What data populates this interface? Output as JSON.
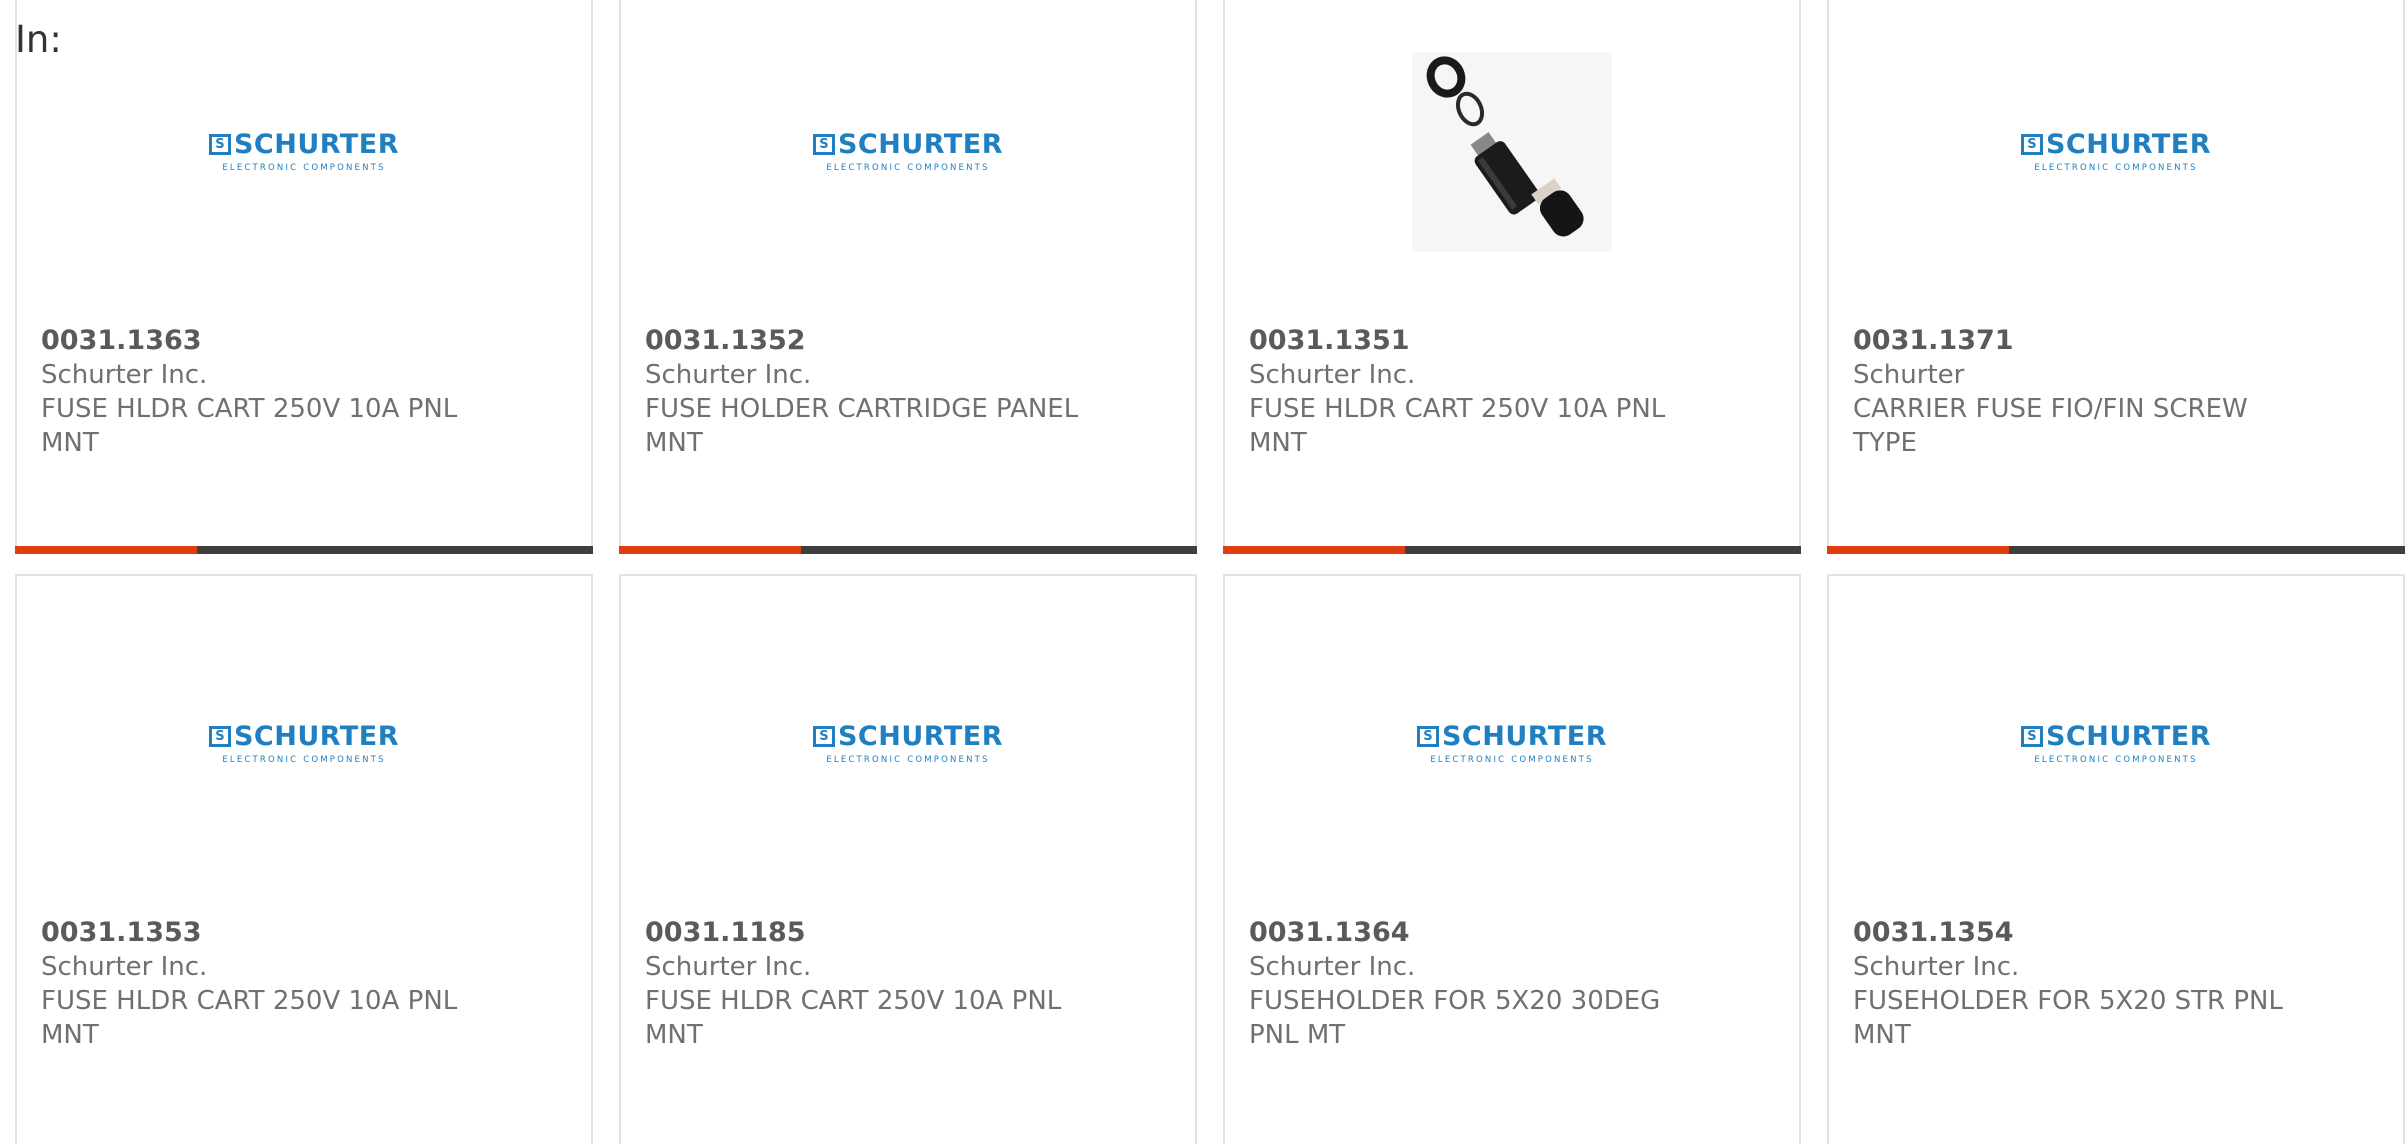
{
  "page": {
    "heading": "In:"
  },
  "brand": {
    "mark": "S",
    "name": "SCHURTER",
    "sub": "ELECTRONIC COMPONENTS",
    "color": "#1f7fc1"
  },
  "colors": {
    "bar_accent": "#e03c0f",
    "bar_dark": "#3f3f3f"
  },
  "products": [
    {
      "part_no": "0031.1363",
      "manufacturer": "Schurter Inc.",
      "description": "FUSE HLDR CART 250V 10A PNL MNT",
      "image": "schurter-logo"
    },
    {
      "part_no": "0031.1352",
      "manufacturer": "Schurter Inc.",
      "description": "FUSE HOLDER CARTRIDGE PANEL MNT",
      "image": "schurter-logo"
    },
    {
      "part_no": "0031.1351",
      "manufacturer": "Schurter Inc.",
      "description": "FUSE HLDR CART 250V 10A PNL MNT",
      "image": "fuse-holder-photo"
    },
    {
      "part_no": "0031.1371",
      "manufacturer": "Schurter",
      "description": "CARRIER FUSE FIO/FIN SCREW TYPE",
      "image": "schurter-logo"
    },
    {
      "part_no": "0031.1353",
      "manufacturer": "Schurter Inc.",
      "description": "FUSE HLDR CART 250V 10A PNL MNT",
      "image": "schurter-logo"
    },
    {
      "part_no": "0031.1185",
      "manufacturer": "Schurter Inc.",
      "description": "FUSE HLDR CART 250V 10A PNL MNT",
      "image": "schurter-logo"
    },
    {
      "part_no": "0031.1364",
      "manufacturer": "Schurter Inc.",
      "description": "FUSEHOLDER FOR 5X20 30DEG PNL MT",
      "image": "schurter-logo"
    },
    {
      "part_no": "0031.1354",
      "manufacturer": "Schurter Inc.",
      "description": "FUSEHOLDER FOR 5X20 STR PNL MNT",
      "image": "schurter-logo"
    }
  ]
}
